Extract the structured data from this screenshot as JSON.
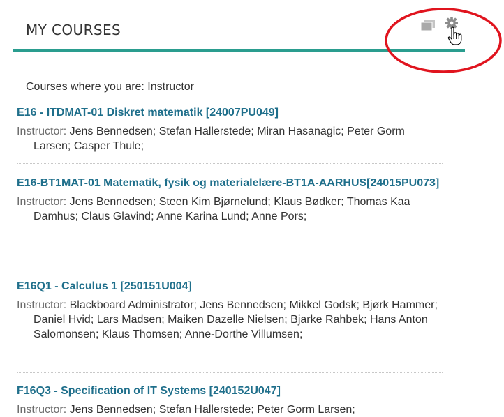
{
  "module": {
    "title": "MY COURSES"
  },
  "toolbar": {
    "manage_icon": "edit-courses-icon",
    "settings_icon": "gear-icon",
    "cursor_icon": "hand-pointer-icon"
  },
  "annotation": {
    "ring_color": "#e0141e"
  },
  "role_heading": "Courses where you are: Instructor",
  "instructor_label": "Instructor:",
  "courses": [
    {
      "title": "E16 - ITDMAT-01 Diskret matematik [24007PU049]",
      "instructors": "Jens Bennedsen;  Stefan Hallerstede;  Miran Hasanagic;  Peter Gorm Larsen;  Casper Thule;"
    },
    {
      "title": "E16-BT1MAT-01 Matematik, fysik og materialelære-BT1A-AARHUS[24015PU073]",
      "instructors": "Jens Bennedsen;  Steen Kim Bjørnelund;  Klaus Bødker;  Thomas Kaa Damhus;  Claus Glavind;  Anne Karina Lund;  Anne Pors;"
    },
    {
      "title": "E16Q1 - Calculus 1 [250151U004]",
      "instructors": "Blackboard Administrator;  Jens Bennedsen;  Mikkel Godsk;  Bjørk Hammer;  Daniel Hvid;  Lars Madsen;  Maiken Dazelle Nielsen;  Bjarke Rahbek;  Hans Anton Salomonsen;  Klaus Thomsen;  Anne-Dorthe Villumsen;"
    },
    {
      "title": "F16Q3 - Specification of IT Systems [240152U047]",
      "instructors": "Jens Bennedsen;  Stefan Hallerstede;  Peter Gorm Larsen;"
    }
  ],
  "colors": {
    "accent": "#2a9d8f",
    "link": "#1f6f8b"
  }
}
